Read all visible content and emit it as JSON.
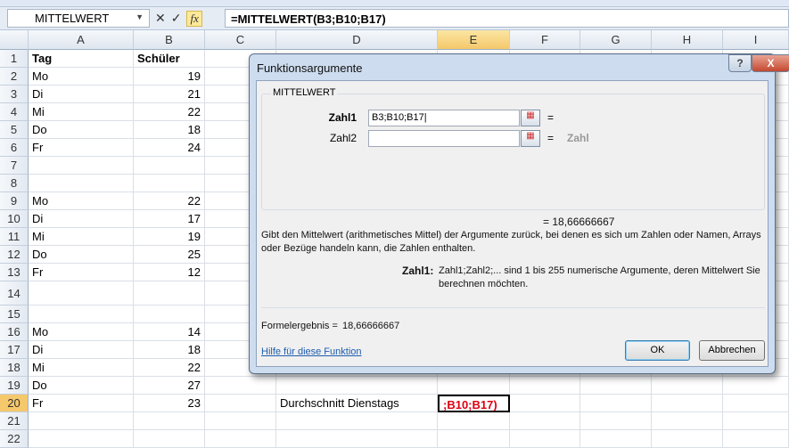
{
  "formula_bar": {
    "name_box": "MITTELWERT",
    "cancel_icon": "✕",
    "enter_icon": "✓",
    "fx_label": "fx",
    "formula": "=MITTELWERT(B3;B10;B17)"
  },
  "columns": [
    "A",
    "B",
    "C",
    "D",
    "E",
    "F",
    "G",
    "H",
    "I"
  ],
  "rows": [
    {
      "n": "1",
      "a": "Tag",
      "b": "Schüler",
      "header": true
    },
    {
      "n": "2",
      "a": "Mo",
      "b": "19"
    },
    {
      "n": "3",
      "a": "Di",
      "b": "21"
    },
    {
      "n": "4",
      "a": "Mi",
      "b": "22"
    },
    {
      "n": "5",
      "a": "Do",
      "b": "18"
    },
    {
      "n": "6",
      "a": "Fr",
      "b": "24"
    },
    {
      "n": "7",
      "a": "",
      "b": ""
    },
    {
      "n": "8",
      "a": "",
      "b": ""
    },
    {
      "n": "9",
      "a": "Mo",
      "b": "22"
    },
    {
      "n": "10",
      "a": "Di",
      "b": "17"
    },
    {
      "n": "11",
      "a": "Mi",
      "b": "19"
    },
    {
      "n": "12",
      "a": "Do",
      "b": "25"
    },
    {
      "n": "13",
      "a": "Fr",
      "b": "12"
    },
    {
      "n": "14",
      "a": "",
      "b": ""
    },
    {
      "n": "15",
      "a": "",
      "b": ""
    },
    {
      "n": "16",
      "a": "Mo",
      "b": "14"
    },
    {
      "n": "17",
      "a": "Di",
      "b": "18"
    },
    {
      "n": "18",
      "a": "Mi",
      "b": "22"
    },
    {
      "n": "19",
      "a": "Do",
      "b": "27"
    },
    {
      "n": "20",
      "a": "Fr",
      "b": "23",
      "d": "Durchschnitt Dienstags",
      "e": ";B10;B17)"
    },
    {
      "n": "21",
      "a": "",
      "b": ""
    },
    {
      "n": "22",
      "a": "",
      "b": ""
    }
  ],
  "dialog": {
    "title": "Funktionsargumente",
    "help": "?",
    "close": "X",
    "function_name": "MITTELWERT",
    "args": [
      {
        "label": "Zahl1",
        "value": "B3;B10;B17",
        "result": "="
      },
      {
        "label": "Zahl2",
        "value": "",
        "result": "=",
        "hint": "Zahl"
      }
    ],
    "result_line": "=   18,66666667",
    "description": "Gibt den Mittelwert (arithmetisches Mittel) der Argumente zurück, bei denen es sich um Zahlen oder Namen, Arrays oder Bezüge handeln kann, die Zahlen enthalten.",
    "arg_help_label": "Zahl1:",
    "arg_help": "Zahl1;Zahl2;... sind 1 bis 255 numerische Argumente, deren Mittelwert Sie berechnen möchten.",
    "formula_result_label": "Formelergebnis =",
    "formula_result": "18,66666667",
    "help_link": "Hilfe für diese Funktion",
    "ok": "OK",
    "cancel": "Abbrechen"
  }
}
